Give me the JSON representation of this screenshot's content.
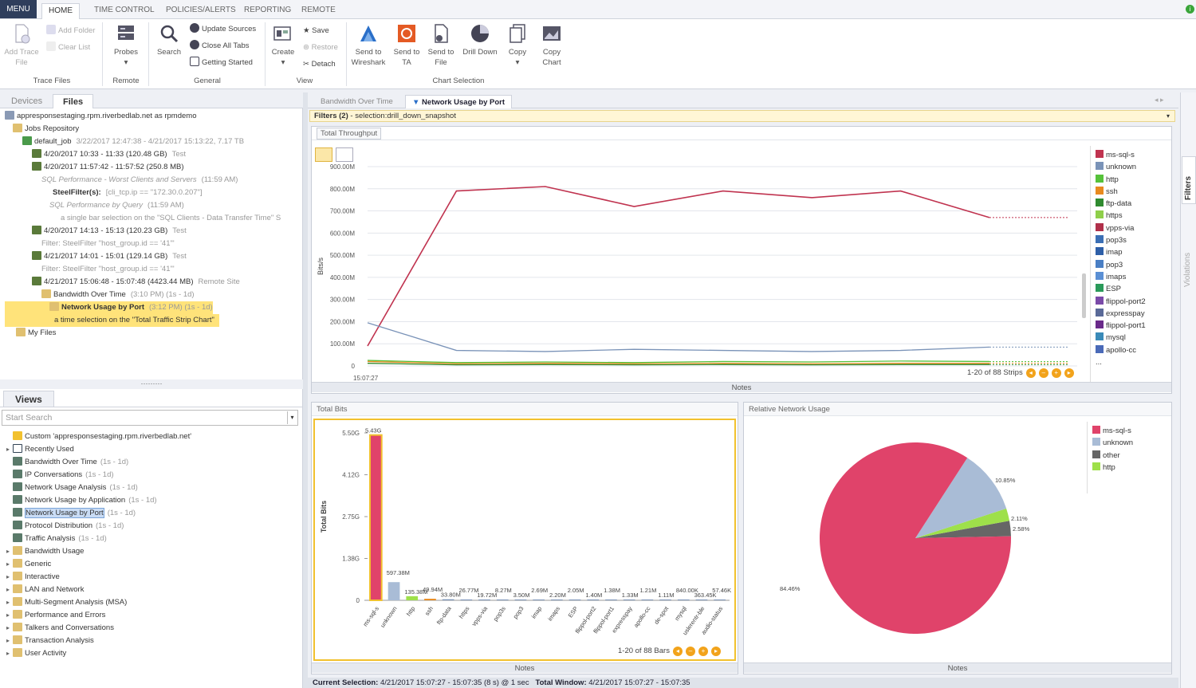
{
  "menubar": {
    "menu": "MENU",
    "tabs": [
      "HOME",
      "TIME CONTROL",
      "POLICIES/ALERTS",
      "REPORTING",
      "REMOTE"
    ]
  },
  "ribbon": {
    "add_trace_file": "Add Trace File",
    "add_folder": "Add Folder",
    "clear_list": "Clear List",
    "probes": "Probes",
    "search": "Search",
    "update_sources": "Update Sources",
    "close_all_tabs": "Close All Tabs",
    "getting_started": "Getting Started",
    "create": "Create",
    "save": "Save",
    "restore": "Restore",
    "detach": "Detach",
    "send_wireshark": "Send to Wireshark",
    "send_ta": "Send to TA",
    "send_file": "Send to File",
    "drill_down": "Drill Down",
    "copy": "Copy",
    "copy_chart": "Copy Chart",
    "groups": {
      "trace_files": "Trace Files",
      "remote": "Remote",
      "general": "General",
      "view": "View",
      "chart_selection": "Chart Selection"
    }
  },
  "left_top": {
    "tabs": [
      "Devices",
      "Files"
    ],
    "tree": [
      {
        "t": "appresponsestaging.rpm.riverbedlab.net as rpmdemo",
        "d": ""
      },
      {
        "t": "Jobs Repository",
        "d": ""
      },
      {
        "t": "default_job",
        "d": "3/22/2017 12:47:38 - 4/21/2017 15:13:22, 7.17 TB"
      },
      {
        "t": "4/20/2017 10:33 - 11:33 (120.48 GB)",
        "d": "Test"
      },
      {
        "t": "4/20/2017 11:57:42 - 11:57:52 (250.8 MB)",
        "d": ""
      },
      {
        "t": "SQL Performance - Worst Clients and Servers",
        "d": "(11:59 AM)"
      },
      {
        "t": "SteelFilter(s):",
        "d": "[cli_tcp.ip == \"172.30.0.207\"]"
      },
      {
        "t": "SQL Performance by Query",
        "d": "(11:59 AM)"
      },
      {
        "t": "a single bar selection on the \"SQL Clients - Data Transfer Time\" S",
        "d": ""
      },
      {
        "t": "4/20/2017 14:13 - 15:13 (120.23 GB)",
        "d": "Test"
      },
      {
        "t": "Filter: SteelFilter \"host_group.id == '41'\"",
        "d": ""
      },
      {
        "t": "4/21/2017 14:01 - 15:01 (129.14 GB)",
        "d": "Test"
      },
      {
        "t": "Filter: SteelFilter \"host_group.id == '41'\"",
        "d": ""
      },
      {
        "t": "4/21/2017 15:06:48 - 15:07:48 (4423.44 MB)",
        "d": "Remote Site"
      },
      {
        "t": "Bandwidth Over Time",
        "d": "(3:10 PM) (1s - 1d)"
      },
      {
        "t": "Network Usage by Port",
        "d": "(3:12 PM) (1s - 1d)"
      },
      {
        "t": "a time selection on the \"Total Traffic Strip Chart\"",
        "d": ""
      },
      {
        "t": "My Files",
        "d": ""
      }
    ]
  },
  "views": {
    "title": "Views",
    "search_placeholder": "Start Search",
    "items": [
      {
        "t": "Custom 'appresponsestaging.rpm.riverbedlab.net'",
        "d": ""
      },
      {
        "t": "Recently Used",
        "d": ""
      },
      {
        "t": "Bandwidth Over Time",
        "d": "(1s - 1d)"
      },
      {
        "t": "IP Conversations",
        "d": "(1s - 1d)"
      },
      {
        "t": "Network Usage Analysis",
        "d": "(1s - 1d)"
      },
      {
        "t": "Network Usage by Application",
        "d": "(1s - 1d)"
      },
      {
        "t": "Network Usage by Port",
        "d": "(1s - 1d)"
      },
      {
        "t": "Protocol Distribution",
        "d": "(1s - 1d)"
      },
      {
        "t": "Traffic Analysis",
        "d": "(1s - 1d)"
      },
      {
        "t": "Bandwidth Usage",
        "d": ""
      },
      {
        "t": "Generic",
        "d": ""
      },
      {
        "t": "Interactive",
        "d": ""
      },
      {
        "t": "LAN and Network",
        "d": ""
      },
      {
        "t": "Multi-Segment Analysis (MSA)",
        "d": ""
      },
      {
        "t": "Performance and Errors",
        "d": ""
      },
      {
        "t": "Talkers and Conversations",
        "d": ""
      },
      {
        "t": "Transaction Analysis",
        "d": ""
      },
      {
        "t": "User Activity",
        "d": ""
      }
    ]
  },
  "right": {
    "tabs": [
      "Bandwidth Over Time",
      "Network Usage by Port"
    ],
    "filter_label": "Filters (2)",
    "filter_text": "- selection:drill_down_snapshot",
    "notes": "Notes",
    "strips_label": "1-20 of 88 Strips",
    "bars_label": "1-20 of 88 Bars",
    "status_label": "Current Selection:",
    "status_value": "4/21/2017 15:07:27 - 15:07:35 (8 s) @ 1 sec",
    "window_label": "Total Window:",
    "window_value": "4/21/2017 15:07:27 - 15:07:35",
    "side_tabs": [
      "Filters",
      "Violations"
    ]
  },
  "colors": {
    "accent": "#f2a31b",
    "ms_sql_s": "#e0436a",
    "unknown": "#a9bcd6",
    "other": "#666666",
    "http": "#9ee04a",
    "selection": "#ffe37a"
  },
  "chart_data": [
    {
      "type": "line",
      "title": "Total Throughput",
      "ylabel": "Bits/s",
      "x": [
        "15:07:27",
        "",
        "",
        "",
        "",
        "",
        "",
        "",
        "",
        ""
      ],
      "yticks": [
        "900.00M",
        "800.00M",
        "700.00M",
        "600.00M",
        "500.00M",
        "400.00M",
        "300.00M",
        "200.00M",
        "100.00M",
        "0"
      ],
      "ylim": [
        0,
        900000000
      ],
      "series": [
        {
          "name": "ms-sql-s",
          "values": [
            90,
            790,
            810,
            720,
            790,
            760,
            790,
            670
          ]
        },
        {
          "name": "unknown",
          "values": [
            195,
            70,
            65,
            75,
            70,
            65,
            70,
            85
          ]
        },
        {
          "name": "http",
          "values": [
            25,
            15,
            18,
            15,
            20,
            18,
            22,
            20
          ]
        },
        {
          "name": "ssh",
          "values": [
            20,
            10,
            12,
            10,
            12,
            10,
            12,
            12
          ]
        },
        {
          "name": "ftp-data",
          "values": [
            12,
            5,
            6,
            5,
            6,
            5,
            6,
            6
          ]
        }
      ],
      "legend": [
        "ms-sql-s",
        "unknown",
        "http",
        "ssh",
        "ftp-data",
        "https",
        "vpps-via",
        "pop3s",
        "imap",
        "pop3",
        "imaps",
        "ESP",
        "flippol-port2",
        "expresspay",
        "flippol-port1",
        "mysql",
        "apollo-cc",
        "..."
      ],
      "legend_colors": [
        "#c0334f",
        "#7a93b8",
        "#56c23a",
        "#e88a1f",
        "#2f8a2f",
        "#8fcf4a",
        "#b0304a",
        "#3b6fb5",
        "#2e5fa8",
        "#4a7fc4",
        "#5a8fd4",
        "#2a9a5a",
        "#7a4aa8",
        "#5a6a98",
        "#6a2a8a",
        "#3a8ab8",
        "#4a6ab8",
        "#999999"
      ]
    },
    {
      "type": "bar",
      "title": "Total Bits",
      "ylabel": "Total Bits",
      "yticks": [
        "5.50G",
        "4.12G",
        "2.75G",
        "1.38G",
        "0"
      ],
      "ylim": [
        0,
        5.5
      ],
      "categories": [
        "ms-sql-s",
        "unknown",
        "http",
        "ssh",
        "ftp-data",
        "https",
        "vpps-via",
        "pop3s",
        "pop3",
        "imap",
        "imaps",
        "ESP",
        "flippol-port2",
        "flippol-port1",
        "expresspay",
        "apollo-cc",
        "de-spot",
        "mysql",
        "uslerentr-ble",
        "audio-status"
      ],
      "value_labels": [
        "5.43G",
        "597.38M",
        "135.38M",
        "49.94M",
        "33.80M",
        "26.77M",
        "19.72M",
        "8.27M",
        "3.50M",
        "2.69M",
        "2.20M",
        "2.05M",
        "1.40M",
        "1.38M",
        "1.33M",
        "1.21M",
        "1.11M",
        "840.00K",
        "363.45K",
        "57.46K"
      ],
      "values": [
        5.43,
        0.597,
        0.135,
        0.0499,
        0.0338,
        0.0268,
        0.0197,
        0.0083,
        0.0035,
        0.0027,
        0.0022,
        0.0021,
        0.0014,
        0.0014,
        0.0013,
        0.0012,
        0.0011,
        0.00084,
        0.00036,
        6e-05
      ]
    },
    {
      "type": "pie",
      "title": "Relative Network Usage",
      "slices": [
        {
          "name": "ms-sql-s",
          "value": 84.46
        },
        {
          "name": "unknown",
          "value": 10.85
        },
        {
          "name": "http",
          "value": 2.11
        },
        {
          "name": "other",
          "value": 2.58
        }
      ],
      "labels": [
        "84.46%",
        "10.85%",
        "2.11%",
        "2.58%"
      ],
      "legend": [
        "ms-sql-s",
        "unknown",
        "other",
        "http"
      ]
    }
  ]
}
